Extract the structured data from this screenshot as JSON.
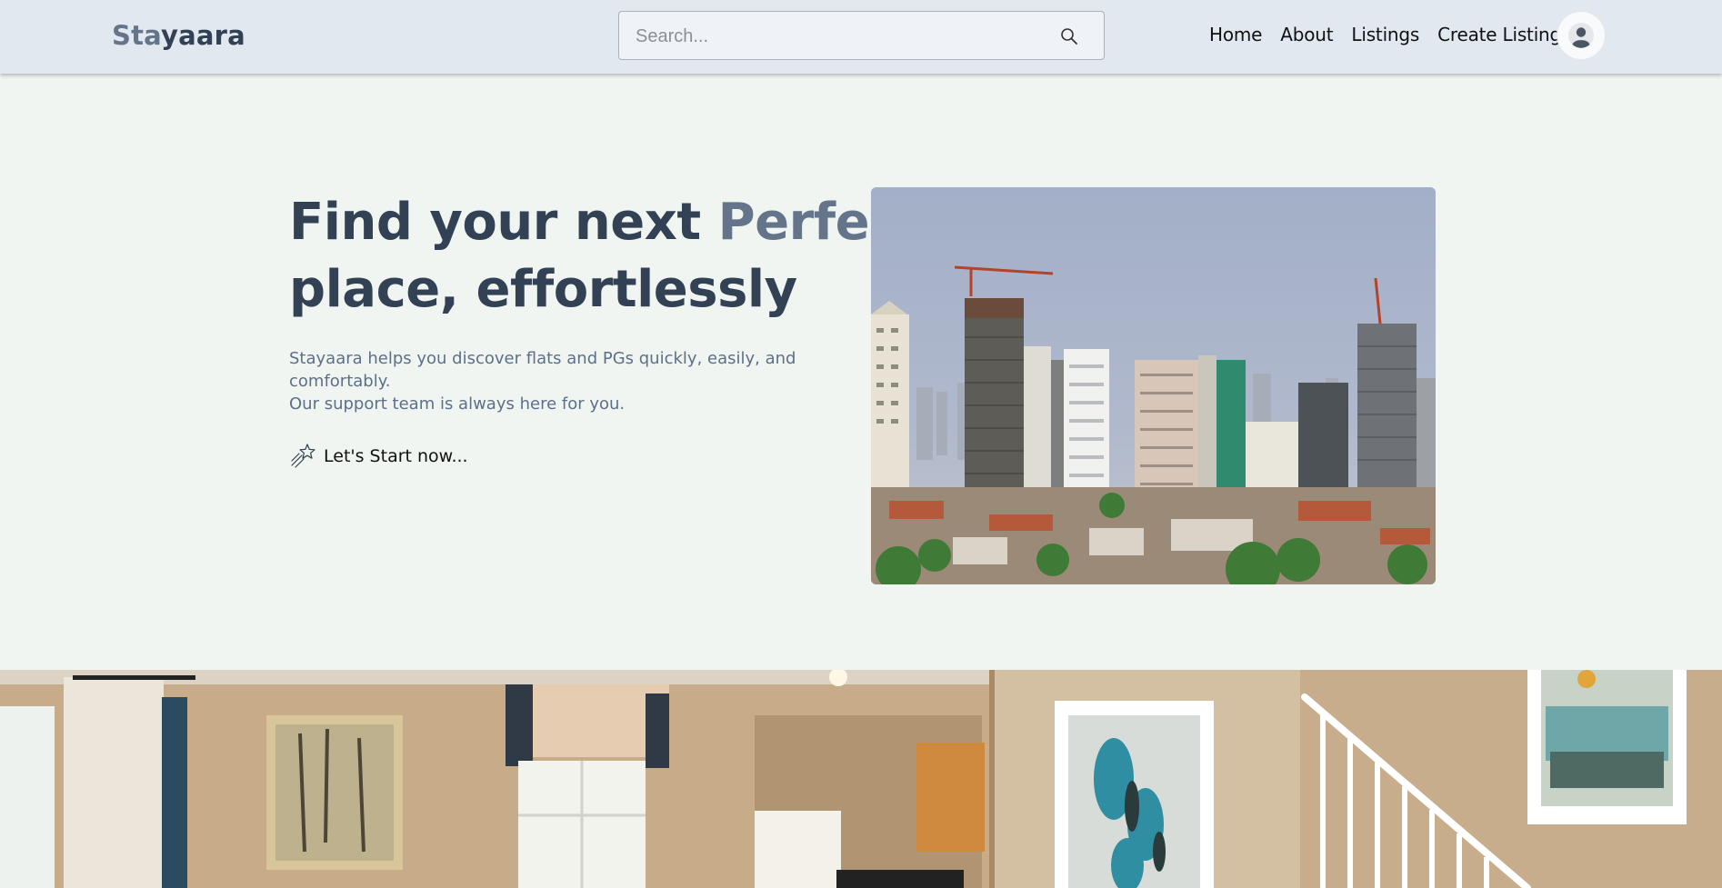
{
  "brand": {
    "prefix": "Sta",
    "suffix": "yaara"
  },
  "search": {
    "placeholder": "Search..."
  },
  "nav": {
    "links": [
      "Home",
      "About",
      "Listings",
      "Create Listing"
    ]
  },
  "hero": {
    "title_part1": "Find your next ",
    "title_accent": "Perfect",
    "title_part2": "place, effortlessly",
    "description_line1": "Stayaara helps you discover flats and PGs quickly, easily, and comfortably.",
    "description_line2": "Our support team is always here for you.",
    "cta_label": "Let's Start now..."
  },
  "icons": {
    "search": "search-icon",
    "avatar": "user-avatar-icon",
    "cta": "shooting-star-icon"
  },
  "colors": {
    "navbar_bg": "#e2e8f0",
    "page_bg": "#f0f5f1",
    "title_dark": "#334155",
    "title_accent": "#64748b",
    "description": "#5d6f89"
  }
}
